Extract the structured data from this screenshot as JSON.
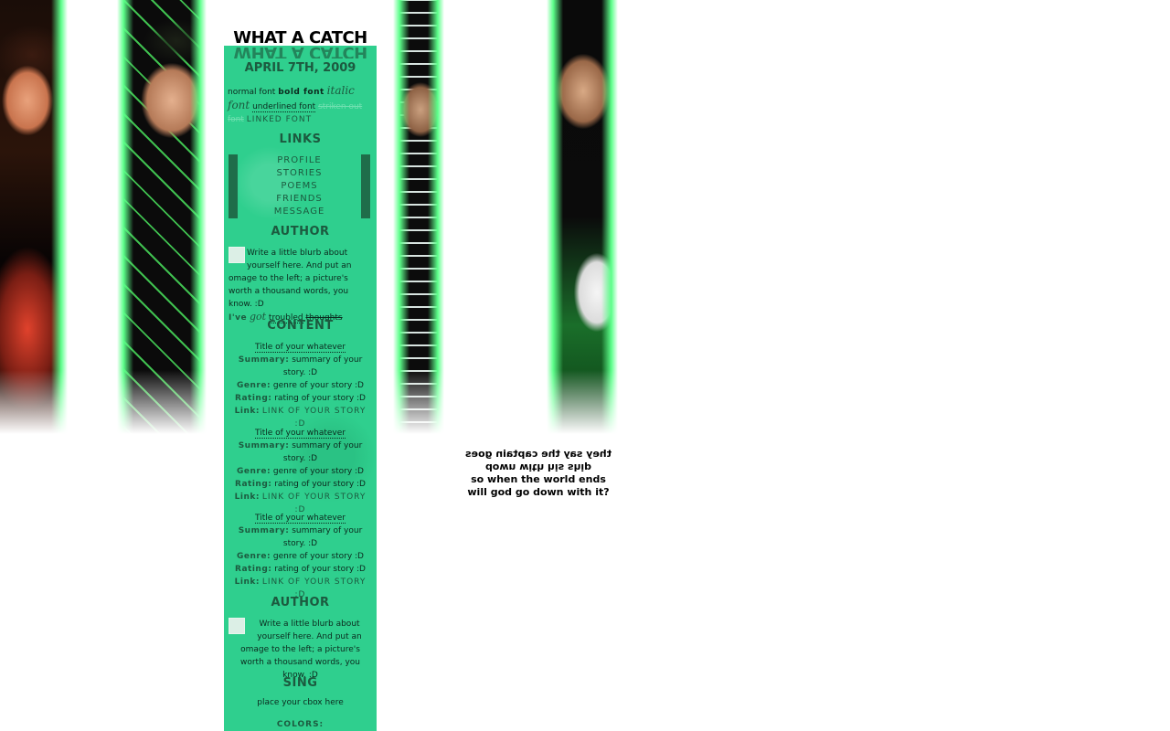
{
  "header": {
    "title": "WHAT A CATCH",
    "title_mirror": "WHAT A CATCH",
    "date": "APRIL 7TH, 2009"
  },
  "fonts_demo": {
    "normal": "normal font",
    "bold": "bold font",
    "italic": "italic font",
    "underlined": "underlined font",
    "struck": "striken out font",
    "linked": "LINKED FONT"
  },
  "links": {
    "heading": "LINKS",
    "items": [
      "PROFILE",
      "STORIES",
      "POEMS",
      "FRIENDS",
      "MESSAGE"
    ]
  },
  "author": {
    "heading": "AUTHOR",
    "blurb": "Write a little blurb about yourself here. And put an omage to the left; a picture's worth a thousand words, you know. :D",
    "mood": {
      "b": "I've",
      "i": "got",
      "u": "troubled",
      "s": "thoughts"
    }
  },
  "content": {
    "heading": "CONTENT",
    "stories": [
      {
        "title": "Title of your whatever",
        "summary_label": "Summary:",
        "summary": "summary of your story. :D",
        "genre_label": "Genre:",
        "genre": "genre of your story :D",
        "rating_label": "Rating:",
        "rating": "rating of your story :D",
        "link_label": "Link:",
        "link": "LINK OF YOUR STORY :D"
      },
      {
        "title": "Title of your whatever",
        "summary_label": "Summary:",
        "summary": "summary of your story. :D",
        "genre_label": "Genre:",
        "genre": "genre of your story :D",
        "rating_label": "Rating:",
        "rating": "rating of your story :D",
        "link_label": "Link:",
        "link": "LINK OF YOUR STORY :D"
      },
      {
        "title": "Title of your whatever",
        "summary_label": "Summary:",
        "summary": "summary of your story. :D",
        "genre_label": "Genre:",
        "genre": "genre of your story :D",
        "rating_label": "Rating:",
        "rating": "rating of your story :D",
        "link_label": "Link:",
        "link": "LINK OF YOUR STORY :D"
      }
    ]
  },
  "author2": {
    "heading": "AUTHOR",
    "blurb": "Write a little blurb about yourself here. And put an omage to the left; a picture's worth a thousand words, you know. :D"
  },
  "sing": {
    "heading": "SING",
    "cbox": "place your cbox here",
    "colors": "COLORS:"
  },
  "quote": {
    "line1": "they say the captain goes",
    "line2": "down with his ship",
    "line3": "so when the world ends",
    "line4": "will god go down with it?"
  },
  "colors": {
    "column_bg": "#2fcf8e",
    "accent_dark": "#1c5a3f",
    "glow": "#5cff8a"
  }
}
